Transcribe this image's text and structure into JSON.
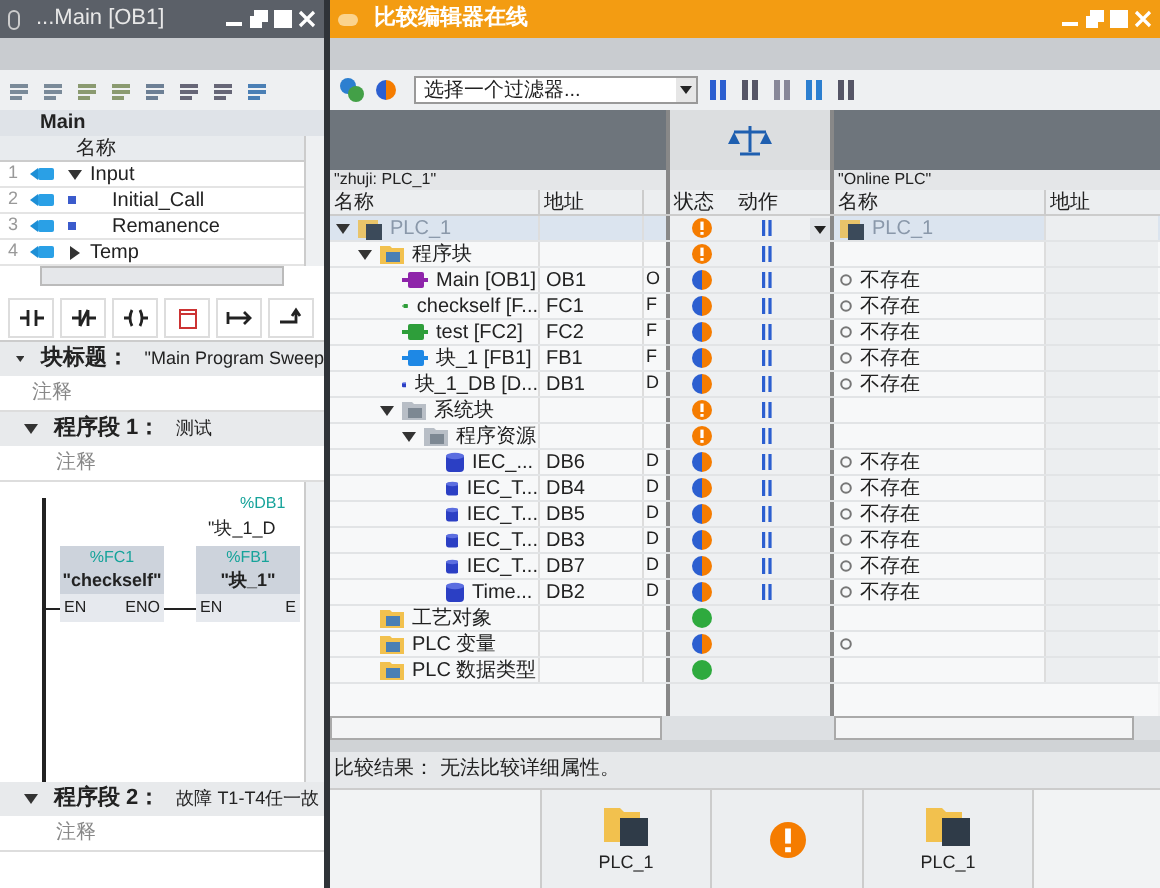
{
  "program_editor": {
    "title": "...Main [OB1]",
    "block_name": "Main",
    "interface": {
      "column": "名称",
      "rows": [
        {
          "number": "1",
          "name": "Input",
          "kind": "section",
          "expanded": true
        },
        {
          "number": "2",
          "name": "Initial_Call",
          "kind": "param"
        },
        {
          "number": "3",
          "name": "Remanence",
          "kind": "param"
        },
        {
          "number": "4",
          "name": "Temp",
          "kind": "section",
          "expanded": false
        }
      ]
    },
    "block_title": {
      "label": "块标题：",
      "value": "\"Main Program Sweep"
    },
    "block_comment": "注释",
    "networks": [
      {
        "label": "程序段 1：",
        "title": "测试",
        "comment": "注释",
        "expanded": true,
        "boxes": [
          {
            "address": "%FC1",
            "name": "\"checkself\"",
            "input": "EN",
            "output": "ENO"
          },
          {
            "instance_address": "%DB1",
            "instance_name": "\"块_1_D",
            "address": "%FB1",
            "name": "\"块_1\"",
            "input": "EN",
            "output": "E"
          }
        ]
      },
      {
        "label": "程序段 2：",
        "title": "故障 T1-T4任一故",
        "comment": "注释",
        "expanded": true
      }
    ]
  },
  "compare_editor": {
    "title": "比较编辑器在线",
    "filter": {
      "value": "选择一个过滤器..."
    },
    "left_header": "\"zhuji: PLC_1\"",
    "right_header": "\"Online PLC\"",
    "columns": {
      "left": [
        "名称",
        "地址"
      ],
      "center": [
        "状态",
        "动作"
      ],
      "right": [
        "名称",
        "地址"
      ]
    },
    "tree": [
      {
        "name": "PLC_1",
        "kind": "device",
        "status": {
          "kind": "warning"
        },
        "action": true,
        "online_name": "PLC_1",
        "online_marker": false,
        "selected": true,
        "expanded": true,
        "children": [
          {
            "name": "程序块",
            "kind": "folder",
            "status": {
              "kind": "warning"
            },
            "action": true,
            "online_marker": false,
            "selected": false,
            "expanded": true,
            "children": [
              {
                "name": "Main [OB1]",
                "kind": "ob",
                "address": "OB1",
                "type": "O",
                "status": {
                  "kind": "different"
                },
                "action": true,
                "online_name": "不存在",
                "online_marker": true,
                "selected": false
              },
              {
                "name": "checkself [F...",
                "kind": "fc",
                "address": "FC1",
                "type": "F",
                "status": {
                  "kind": "different"
                },
                "action": true,
                "online_name": "不存在",
                "online_marker": true,
                "selected": false
              },
              {
                "name": "test [FC2]",
                "kind": "fc",
                "address": "FC2",
                "type": "F",
                "status": {
                  "kind": "different"
                },
                "action": true,
                "online_name": "不存在",
                "online_marker": true,
                "selected": false
              },
              {
                "name": "块_1 [FB1]",
                "kind": "fb",
                "address": "FB1",
                "type": "F",
                "status": {
                  "kind": "different"
                },
                "action": true,
                "online_name": "不存在",
                "online_marker": true,
                "selected": false
              },
              {
                "name": "块_1_DB [D...",
                "kind": "db",
                "address": "DB1",
                "type": "D",
                "status": {
                  "kind": "different"
                },
                "action": true,
                "online_name": "不存在",
                "online_marker": true,
                "selected": false
              },
              {
                "name": "系统块",
                "kind": "system",
                "status": {
                  "kind": "warning"
                },
                "action": true,
                "online_marker": false,
                "selected": false,
                "expanded": true,
                "children": [
                  {
                    "name": "程序资源",
                    "kind": "system",
                    "status": {
                      "kind": "warning"
                    },
                    "action": true,
                    "online_marker": false,
                    "selected": false,
                    "expanded": true,
                    "children": [
                      {
                        "name": "IEC_...",
                        "kind": "db",
                        "address": "DB6",
                        "type": "D",
                        "status": {
                          "kind": "different"
                        },
                        "action": true,
                        "online_name": "不存在",
                        "online_marker": true,
                        "selected": false
                      },
                      {
                        "name": "IEC_T...",
                        "kind": "db",
                        "address": "DB4",
                        "type": "D",
                        "status": {
                          "kind": "different"
                        },
                        "action": true,
                        "online_name": "不存在",
                        "online_marker": true,
                        "selected": false
                      },
                      {
                        "name": "IEC_T...",
                        "kind": "db",
                        "address": "DB5",
                        "type": "D",
                        "status": {
                          "kind": "different"
                        },
                        "action": true,
                        "online_name": "不存在",
                        "online_marker": true,
                        "selected": false
                      },
                      {
                        "name": "IEC_T...",
                        "kind": "db",
                        "address": "DB3",
                        "type": "D",
                        "status": {
                          "kind": "different"
                        },
                        "action": true,
                        "online_name": "不存在",
                        "online_marker": true,
                        "selected": false
                      },
                      {
                        "name": "IEC_T...",
                        "kind": "db",
                        "address": "DB7",
                        "type": "D",
                        "status": {
                          "kind": "different"
                        },
                        "action": true,
                        "online_name": "不存在",
                        "online_marker": true,
                        "selected": false
                      },
                      {
                        "name": "Time...",
                        "kind": "db",
                        "address": "DB2",
                        "type": "D",
                        "status": {
                          "kind": "different"
                        },
                        "action": true,
                        "online_name": "不存在",
                        "online_marker": true,
                        "selected": false
                      }
                    ]
                  }
                ]
              }
            ]
          },
          {
            "name": "工艺对象",
            "kind": "folder",
            "status": {
              "kind": "identical"
            },
            "action": false,
            "online_marker": false,
            "selected": false
          },
          {
            "name": "PLC 变量",
            "kind": "folder",
            "status": {
              "kind": "different"
            },
            "action": false,
            "online_marker": true,
            "selected": false
          },
          {
            "name": "PLC 数据类型",
            "kind": "folder",
            "status": {
              "kind": "identical"
            },
            "action": false,
            "online_marker": false,
            "selected": false
          }
        ]
      }
    ],
    "result": "比较结果： 无法比较详细属性。",
    "detail_panes": [
      {
        "kind": "device",
        "label": "PLC_1"
      },
      {
        "kind": "status",
        "status": {
          "kind": "warning"
        }
      },
      {
        "kind": "device",
        "label": "PLC_1"
      }
    ]
  }
}
